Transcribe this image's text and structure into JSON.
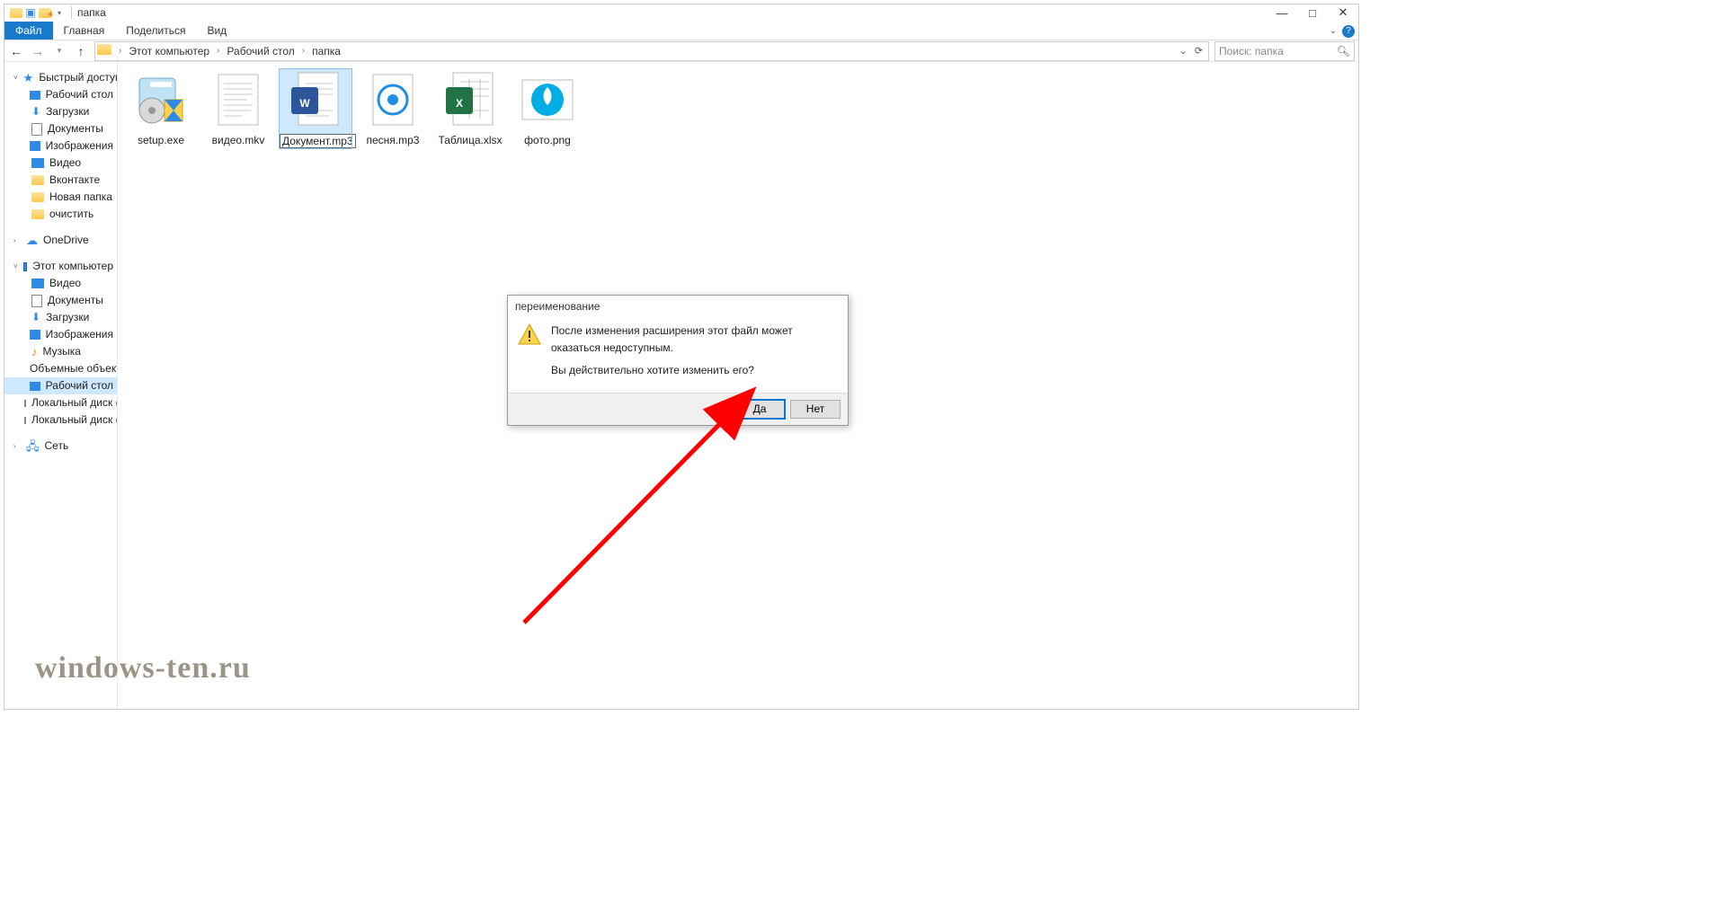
{
  "window": {
    "title": "папка"
  },
  "ribbon": {
    "file": "Файл",
    "tabs": [
      "Главная",
      "Поделиться",
      "Вид"
    ]
  },
  "breadcrumb": {
    "segments": [
      "Этот компьютер",
      "Рабочий стол",
      "папка"
    ]
  },
  "search": {
    "placeholder": "Поиск: папка"
  },
  "sidebar": {
    "quick_access": {
      "label": "Быстрый доступ"
    },
    "quick_items": [
      {
        "label": "Рабочий стол",
        "icon": "desktop",
        "pinned": true
      },
      {
        "label": "Загрузки",
        "icon": "download",
        "pinned": true
      },
      {
        "label": "Документы",
        "icon": "document",
        "pinned": true
      },
      {
        "label": "Изображения",
        "icon": "image",
        "pinned": true
      },
      {
        "label": "Видео",
        "icon": "video",
        "pinned": false
      },
      {
        "label": "Вконтакте",
        "icon": "folder",
        "pinned": false
      },
      {
        "label": "Новая папка",
        "icon": "folder",
        "pinned": false
      },
      {
        "label": "очистить",
        "icon": "folder",
        "pinned": false
      }
    ],
    "onedrive": {
      "label": "OneDrive"
    },
    "this_pc": {
      "label": "Этот компьютер"
    },
    "pc_items": [
      {
        "label": "Видео",
        "icon": "video"
      },
      {
        "label": "Документы",
        "icon": "document"
      },
      {
        "label": "Загрузки",
        "icon": "download"
      },
      {
        "label": "Изображения",
        "icon": "image"
      },
      {
        "label": "Музыка",
        "icon": "music"
      },
      {
        "label": "Объемные объекты",
        "icon": "3d"
      },
      {
        "label": "Рабочий стол",
        "icon": "desktop",
        "selected": true
      },
      {
        "label": "Локальный диск (C",
        "icon": "drive"
      },
      {
        "label": "Локальный диск (D",
        "icon": "drive"
      }
    ],
    "network": {
      "label": "Сеть"
    }
  },
  "files": [
    {
      "name": "setup.exe",
      "type": "installer"
    },
    {
      "name": "видео.mkv",
      "type": "text"
    },
    {
      "name": "Документ.mp3",
      "type": "word",
      "selected": true,
      "editing": true
    },
    {
      "name": "песня.mp3",
      "type": "audio"
    },
    {
      "name": "Таблица.xlsx",
      "type": "excel"
    },
    {
      "name": "фото.png",
      "type": "image"
    }
  ],
  "dialog": {
    "title": "переименование",
    "message": "После изменения расширения этот файл может оказаться недоступным.",
    "question": "Вы действительно хотите изменить его?",
    "yes": "Да",
    "no": "Нет"
  },
  "watermark": "windows-ten.ru"
}
